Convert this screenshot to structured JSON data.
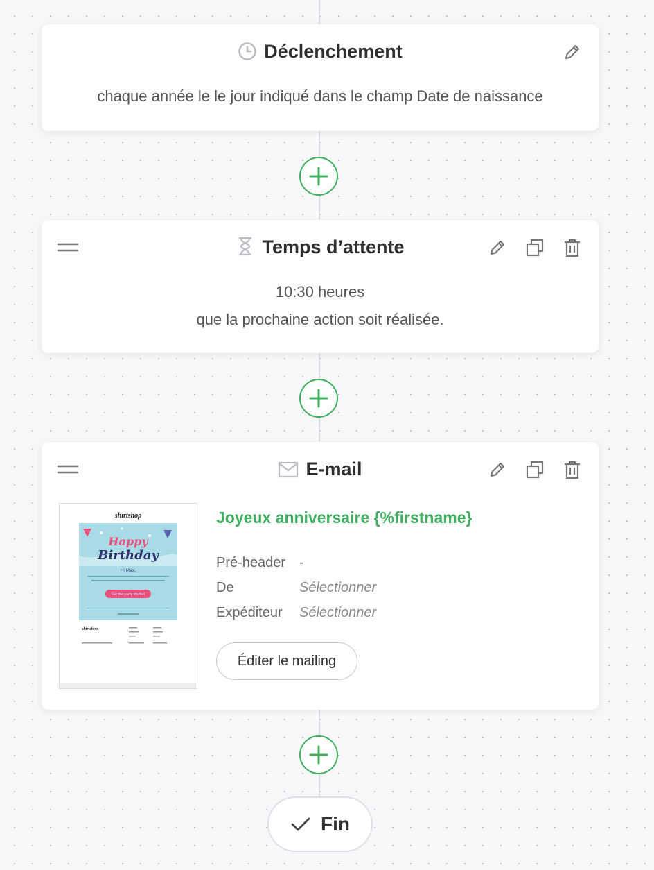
{
  "trigger": {
    "title": "Déclenchement",
    "description": "chaque année le le jour indiqué dans le champ Date de naissance",
    "icon": "clock-icon"
  },
  "wait": {
    "title": "Temps d’attente",
    "line1": "10:30 heures",
    "line2": "que la prochaine action soit réalisée.",
    "icon": "hourglass-icon"
  },
  "email": {
    "title": "E-mail",
    "icon": "envelope-icon",
    "subject": "Joyeux anniversaire {%firstname}",
    "fields": [
      {
        "label": "Pré-header",
        "value": "-"
      },
      {
        "label": "De",
        "value": "Sélectionner"
      },
      {
        "label": "Expéditeur",
        "value": "Sélectionner"
      }
    ],
    "edit_button": "Éditer le mailing",
    "preview": {
      "brand": "shirtshop",
      "headline1": "Happy",
      "headline2": "Birthday",
      "greeting": "Hi Max,",
      "cta": "Get the party started"
    }
  },
  "end": {
    "label": "Fin"
  },
  "colors": {
    "accent": "#3fae5e",
    "text": "#333333",
    "muted": "#888888"
  }
}
